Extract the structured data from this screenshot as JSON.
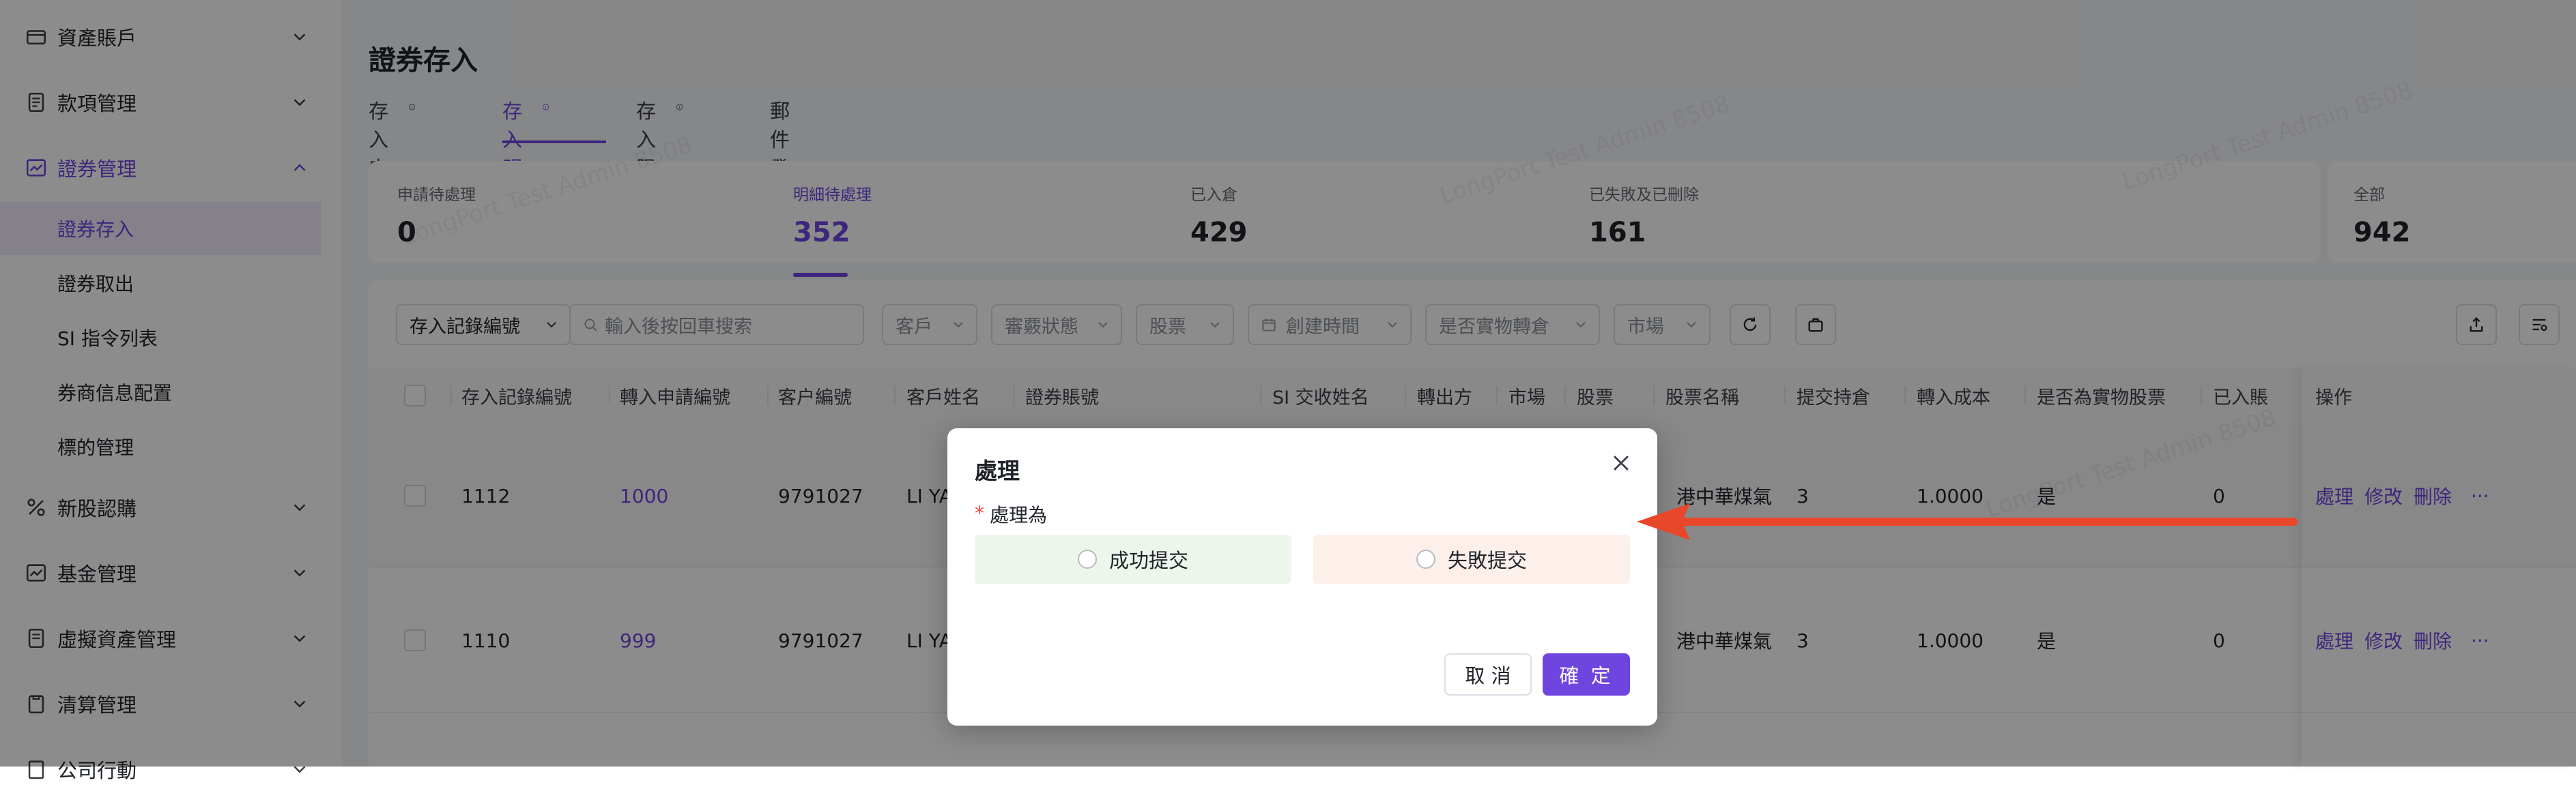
{
  "sidebar": {
    "items": [
      {
        "label": "資產賬戶"
      },
      {
        "label": "款項管理"
      },
      {
        "label": "證券管理"
      },
      {
        "label": "新股認購"
      },
      {
        "label": "基金管理"
      },
      {
        "label": "虛擬資產管理"
      },
      {
        "label": "清算管理"
      },
      {
        "label": "公司行動"
      }
    ],
    "sub_items": [
      {
        "label": "證券存入"
      },
      {
        "label": "證券取出"
      },
      {
        "label": "SI 指令列表"
      },
      {
        "label": "券商信息配置"
      },
      {
        "label": "標的管理"
      }
    ]
  },
  "main": {
    "title": "證券存入",
    "tabs": [
      {
        "label": "存入申請"
      },
      {
        "label": "存入明細"
      },
      {
        "label": "存入限制"
      },
      {
        "label": "郵件發送記錄"
      }
    ],
    "stats": [
      {
        "label": "申請待處理",
        "value": "0"
      },
      {
        "label": "明細待處理",
        "value": "352"
      },
      {
        "label": "已入倉",
        "value": "429"
      },
      {
        "label": "已失敗及已刪除",
        "value": "161"
      },
      {
        "label": "全部",
        "value": "942"
      }
    ],
    "filters": {
      "record_select": "存入記錄編號",
      "search_placeholder": "輸入後按回車搜索",
      "customer": "客戶",
      "review_status": "審覈狀態",
      "stock": "股票",
      "created_time": "創建時間",
      "physical_transfer": "是否實物轉倉",
      "market": "市場"
    },
    "table": {
      "headers": [
        "存入記錄編號",
        "轉入申請編號",
        "客户編號",
        "客戶姓名",
        "證券賬號",
        "SI 交收姓名",
        "轉出方",
        "市場",
        "股票",
        "股票名稱",
        "提交持倉",
        "轉入成本",
        "是否為實物股票",
        "已入賬",
        "操作"
      ],
      "rows": [
        {
          "record_no": "1112",
          "apply_no": "1000",
          "customer_no": "9791027",
          "customer_name": "LI YA",
          "stock_name": "港中華煤氣",
          "qty": "3",
          "cost": "1.0000",
          "physical": "是",
          "credited": "0"
        },
        {
          "record_no": "1110",
          "apply_no": "999",
          "customer_no": "9791027",
          "customer_name": "LI YA",
          "stock_name": "港中華煤氣",
          "qty": "3",
          "cost": "1.0000",
          "physical": "是",
          "credited": "0"
        }
      ],
      "actions": {
        "process": "處理",
        "edit": "修改",
        "delete": "刪除",
        "more": "···"
      }
    },
    "watermark": "LongPort Test Admin 8508"
  },
  "modal": {
    "title": "處理",
    "field_required_mark": "*",
    "field_label": "處理為",
    "options": [
      {
        "label": "成功提交",
        "tone": "#edf6ea"
      },
      {
        "label": "失敗提交",
        "tone": "#fdefea"
      }
    ],
    "cancel_label": "取 消",
    "confirm_label": "確 定"
  },
  "colors": {
    "accent": "#6f45e0",
    "arrow": "#e8472a"
  }
}
